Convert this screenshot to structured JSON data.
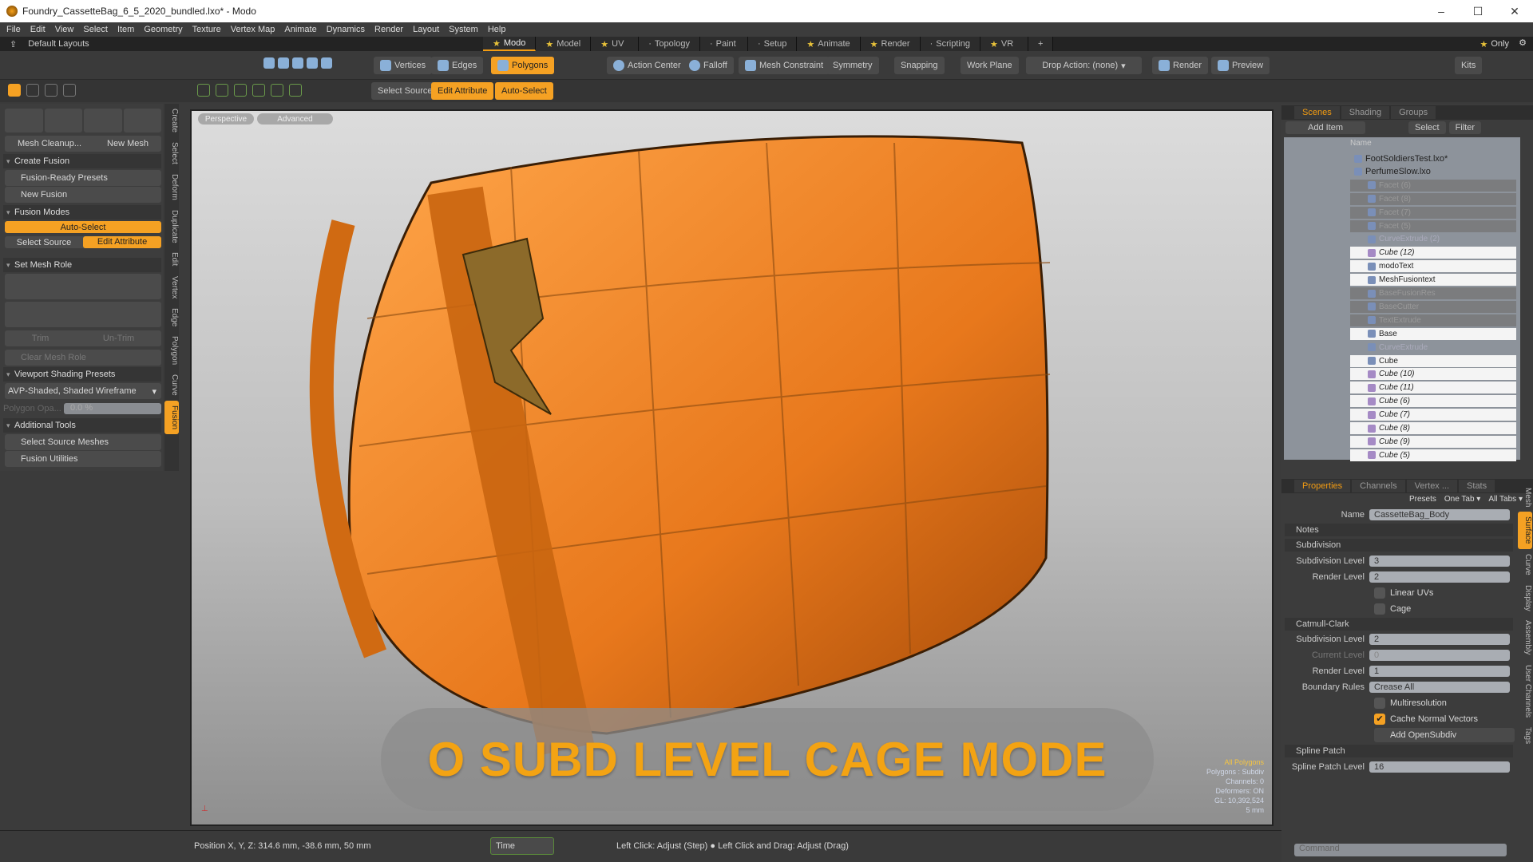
{
  "window": {
    "title": "Foundry_CassetteBag_6_5_2020_bundled.lxo* - Modo",
    "controls": [
      "–",
      "☐",
      "✕"
    ]
  },
  "menu": [
    "File",
    "Edit",
    "View",
    "Select",
    "Item",
    "Geometry",
    "Texture",
    "Vertex Map",
    "Animate",
    "Dynamics",
    "Render",
    "Layout",
    "System",
    "Help"
  ],
  "layouts": {
    "label": "Default Layouts",
    "tabs": [
      "Modo",
      "Model",
      "UV",
      "Topology",
      "Paint",
      "Setup",
      "Animate",
      "Render",
      "Scripting",
      "VR"
    ],
    "add": "+",
    "only": "Only"
  },
  "toolbar1": {
    "vertices": "Vertices",
    "edges": "Edges",
    "polygons": "Polygons",
    "action_center": "Action Center",
    "falloff": "Falloff",
    "mesh_constraint": "Mesh Constraint",
    "symmetry": "Symmetry",
    "snapping": "Snapping",
    "work_plane": "Work Plane",
    "drop_action": "Drop Action: (none)",
    "render": "Render",
    "preview": "Preview",
    "kits": "Kits"
  },
  "toolbar2": {
    "select_source": "Select Source",
    "edit_attribute": "Edit Attribute",
    "auto_select": "Auto-Select"
  },
  "left_panel": {
    "mesh_cleanup": "Mesh Cleanup...",
    "new_mesh": "New Mesh",
    "create_fusion": "Create Fusion",
    "fusion_ready_presets": "Fusion-Ready Presets",
    "new_fusion": "New Fusion",
    "fusion_modes": "Fusion Modes",
    "auto_select": "Auto-Select",
    "select_source": "Select Source",
    "edit_attribute": "Edit Attribute",
    "set_mesh_role": "Set Mesh Role",
    "trim": "Trim",
    "un_trim": "Un-Trim",
    "clear_mesh_role": "Clear Mesh Role",
    "viewport_shading_presets": "Viewport Shading Presets",
    "shading_value": "AVP-Shaded, Shaded Wireframe",
    "polygon_opacity_label": "Polygon Opa...",
    "polygon_opacity_value": "0.0 %",
    "additional_tools": "Additional Tools",
    "select_source_meshes": "Select Source Meshes",
    "fusion_utilities": "Fusion Utilities"
  },
  "vertical_tabs": [
    "Create",
    "Select",
    "Deform",
    "Duplicate",
    "Edit",
    "Vertex",
    "Edge",
    "Polygon",
    "Curve",
    "Fusion"
  ],
  "viewport": {
    "view": "Perspective",
    "style": "Advanced",
    "caption": "O SUBD LEVEL CAGE MODE",
    "info": [
      "All Polygons",
      "Polygons : Subdiv",
      "Channels: 0",
      "Deformers: ON",
      "GL: 10,392,524",
      "5 mm"
    ],
    "accent": "#f3a313"
  },
  "status": {
    "position": "Position X, Y, Z:  314.6 mm, -38.6 mm, 50 mm",
    "time": "Time",
    "hint": "Left Click: Adjust (Step) ● Left Click and Drag: Adjust (Drag)"
  },
  "scene_panel": {
    "tabs": [
      "Scenes",
      "Shading",
      "Groups"
    ],
    "add_item": "Add Item",
    "select": "Select",
    "filter": "Filter",
    "name_col": "Name",
    "items": [
      {
        "label": "FootSoldiersTest.lxo*",
        "state": "file"
      },
      {
        "label": "PerfumeSlow.lxo",
        "state": "file"
      },
      {
        "label": "Facet (6)",
        "state": "dim"
      },
      {
        "label": "Facet (8)",
        "state": "dim"
      },
      {
        "label": "Facet (7)",
        "state": "dim"
      },
      {
        "label": "Facet (5)",
        "state": "dim"
      },
      {
        "label": "CurveExtrude (2)",
        "state": "grp"
      },
      {
        "label": "Cube (12)",
        "state": "sel-it"
      },
      {
        "label": "modoText",
        "state": "sel"
      },
      {
        "label": "MeshFusiontext",
        "state": "sel"
      },
      {
        "label": "BaseFusionRes",
        "state": "dim"
      },
      {
        "label": "BaseCutter",
        "state": "dim"
      },
      {
        "label": "TextExtrude",
        "state": "dim"
      },
      {
        "label": "Base",
        "state": "sel"
      },
      {
        "label": "CurveExtrude",
        "state": "grp"
      },
      {
        "label": "Cube",
        "state": "sel"
      },
      {
        "label": "Cube (10)",
        "state": "sel-it"
      },
      {
        "label": "Cube (11)",
        "state": "sel-it"
      },
      {
        "label": "Cube (6)",
        "state": "sel-it"
      },
      {
        "label": "Cube (7)",
        "state": "sel-it"
      },
      {
        "label": "Cube (8)",
        "state": "sel-it"
      },
      {
        "label": "Cube (9)",
        "state": "sel-it"
      },
      {
        "label": "Cube (5)",
        "state": "sel-it"
      }
    ]
  },
  "properties": {
    "tabs": [
      "Properties",
      "Channels",
      "Vertex ...",
      "Stats"
    ],
    "presets": "Presets",
    "one_tab": "One Tab ▾",
    "all_tabs": "All Tabs ▾",
    "name_label": "Name",
    "name_value": "CassetteBag_Body",
    "notes": "Notes",
    "subdivision": "Subdivision",
    "subdiv_level_label": "Subdivision Level",
    "subdiv_level": "3",
    "render_level_label": "Render Level",
    "render_level": "2",
    "linear_uvs": "Linear UVs",
    "cage": "Cage",
    "catmull": "Catmull-Clark",
    "cc_subdiv_level": "2",
    "current_level_label": "Current Level",
    "current_level": "0",
    "cc_render_level": "1",
    "boundary_rules_label": "Boundary Rules",
    "boundary_rules": "Crease All",
    "multiresolution": "Multiresolution",
    "cache_normal_vectors": "Cache Normal Vectors",
    "cache_checked": true,
    "add_opensubdiv": "Add OpenSubdiv",
    "spline_patch": "Spline Patch",
    "spline_patch_level_label": "Spline Patch Level",
    "spline_patch_level": "16",
    "side_tabs": [
      "Mesh",
      "Surface",
      "Curve",
      "Display",
      "Assembly",
      "User Channels",
      "Tags"
    ],
    "command_placeholder": "Command"
  }
}
